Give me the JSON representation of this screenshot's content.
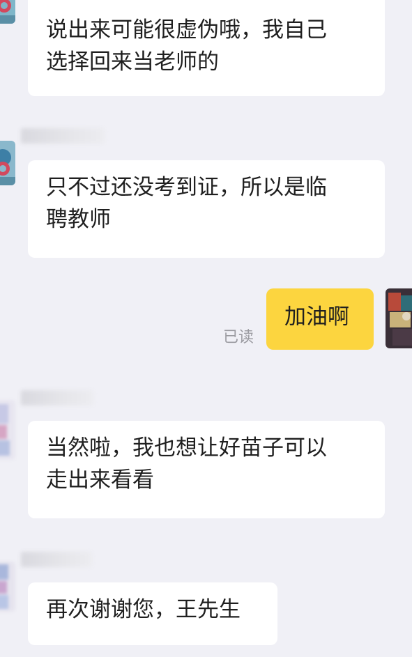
{
  "messages": [
    {
      "side": "left",
      "text": "说出来可能很虚伪哦，我自己\n选择回来当老师的"
    },
    {
      "side": "left",
      "text": "只不过还没考到证，所以是临\n聘教师"
    },
    {
      "side": "right",
      "text": "加油啊",
      "status": "已读"
    },
    {
      "side": "left",
      "text": "当然啦，我也想让好苗子可以\n走出来看看"
    },
    {
      "side": "left",
      "text": "再次谢谢您，王先生"
    }
  ],
  "colors": {
    "background": "#f0f0f6",
    "incoming_bubble": "#ffffff",
    "outgoing_bubble": "#fcd53f",
    "read_status": "#9a9aa0"
  },
  "icons": {
    "contact_avatar": "avatar",
    "self_avatar": "avatar"
  }
}
